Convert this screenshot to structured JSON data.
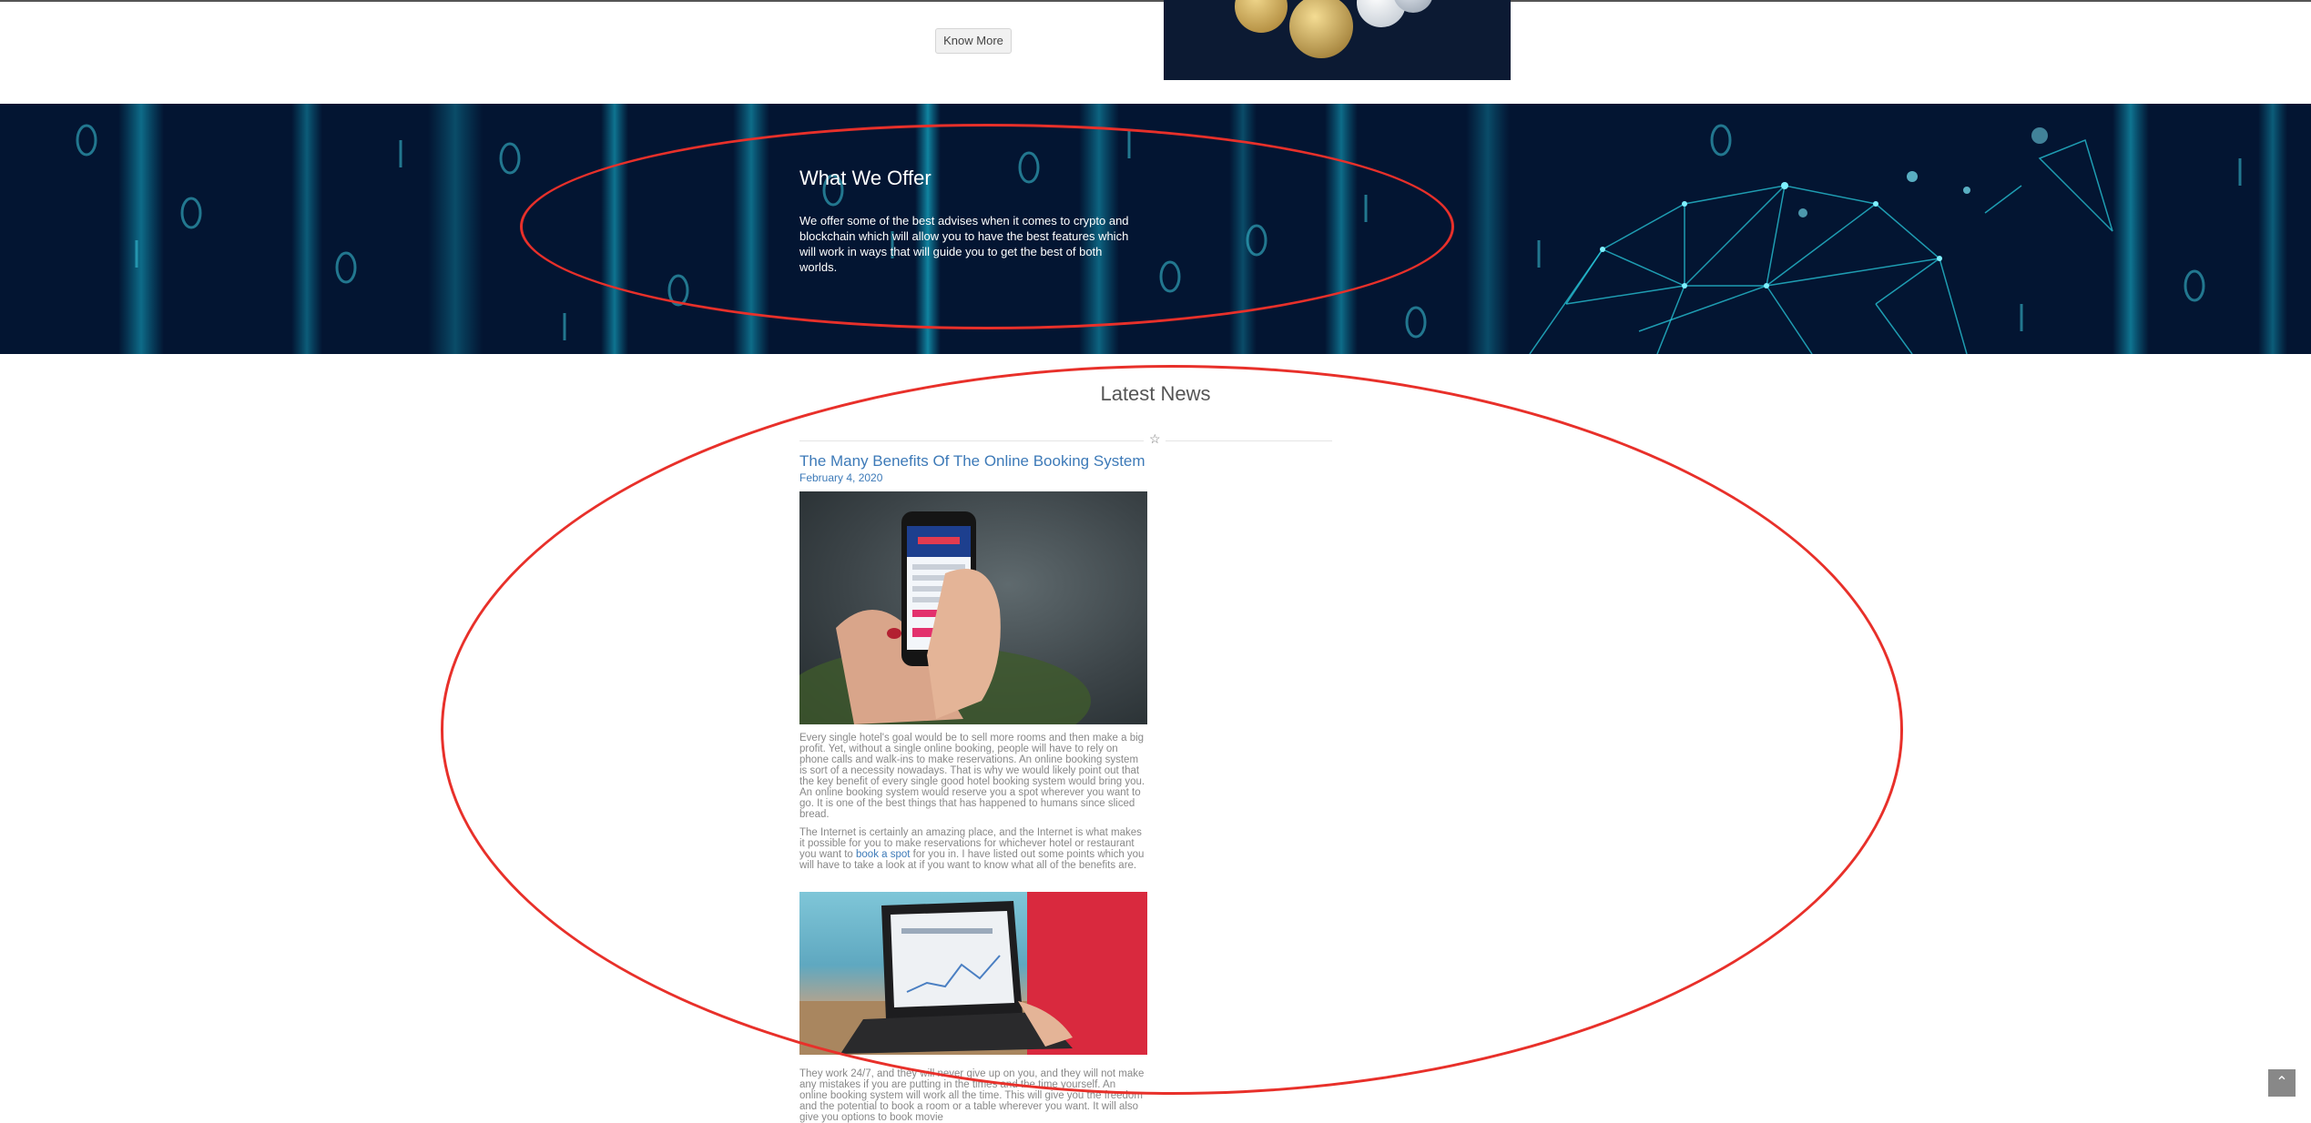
{
  "top_section": {
    "button_label": "Know More"
  },
  "offer": {
    "title": "What We Offer",
    "text": "We offer some of the best advises when it comes to crypto and blockchain which will allow you to have the best features which will work in ways that will guide you to get the best of both worlds."
  },
  "news": {
    "heading": "Latest News",
    "post": {
      "title": "The Many Benefits Of The Online Booking System",
      "date": "February 4, 2020",
      "paragraph1": "Every single hotel's goal would be to sell more rooms and then make a big profit. Yet, without a single online booking, people will have to rely on phone calls and walk-ins to make reservations. An online booking system is sort of a necessity nowadays. That is why we would likely point out that the key benefit of every single good hotel booking system would bring you. An online booking system would reserve you a spot wherever you want to go. It is one of the best things that has happened to humans since sliced bread.",
      "paragraph2_start": "The Internet is certainly an amazing place, and the Internet is what makes it possible for you to make reservations for whichever hotel or restaurant you want to ",
      "paragraph2_link": "book a spot",
      "paragraph2_end": " for you in. I have listed out some points which you will have to take a look at if you want to know what all of the benefits are.",
      "paragraph3": "They work 24/7, and they will never give up on you, and they will not make any mistakes if you are putting in the times and the time yourself. An online booking system will work all the time. This will give you the freedom and the potential to book a room or a table wherever you want. It will also give you options to book movie"
    }
  },
  "icons": {
    "divider": "star-icon",
    "scroll_top": "chevron-up-icon"
  },
  "colors": {
    "link": "#3d7ab8",
    "banner": "#041635",
    "annotation": "#e8302a"
  }
}
